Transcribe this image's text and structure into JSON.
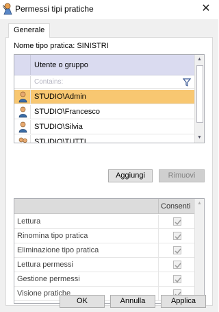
{
  "window": {
    "title": "Permessi tipi pratiche",
    "close_glyph": "✕"
  },
  "tabs": [
    {
      "label": "Generale"
    }
  ],
  "tipo_pratica": {
    "label": "Nome tipo pratica: SINISTRI"
  },
  "users_grid": {
    "column_header": "Utente o gruppo",
    "filter_placeholder": "Contains:",
    "rows": [
      {
        "name": "STUDIO\\Admin",
        "icon": "user-icon",
        "selected": true
      },
      {
        "name": "STUDIO\\Francesco",
        "icon": "user-icon",
        "selected": false
      },
      {
        "name": "STUDIO\\Silvia",
        "icon": "user-icon",
        "selected": false
      },
      {
        "name": "STUDIO\\TUTTI",
        "icon": "group-icon",
        "selected": false
      }
    ]
  },
  "buttons": {
    "aggiungi": "Aggiungi",
    "rimuovi": "Rimuovi"
  },
  "permissions_grid": {
    "column_header": "Consenti",
    "rows": [
      {
        "label": "Lettura",
        "checked": true
      },
      {
        "label": "Rinomina tipo pratica",
        "checked": true
      },
      {
        "label": "Eliminazione tipo pratica",
        "checked": true
      },
      {
        "label": "Lettura permessi",
        "checked": true
      },
      {
        "label": "Gestione permessi",
        "checked": true
      },
      {
        "label": "Visione pratiche",
        "checked": true
      }
    ]
  },
  "footer": {
    "ok": "OK",
    "annulla": "Annulla",
    "applica": "Applica"
  },
  "colors": {
    "selection": "#f8c771",
    "header": "#dadbf0",
    "accent_icon": "#3c6ea8"
  }
}
